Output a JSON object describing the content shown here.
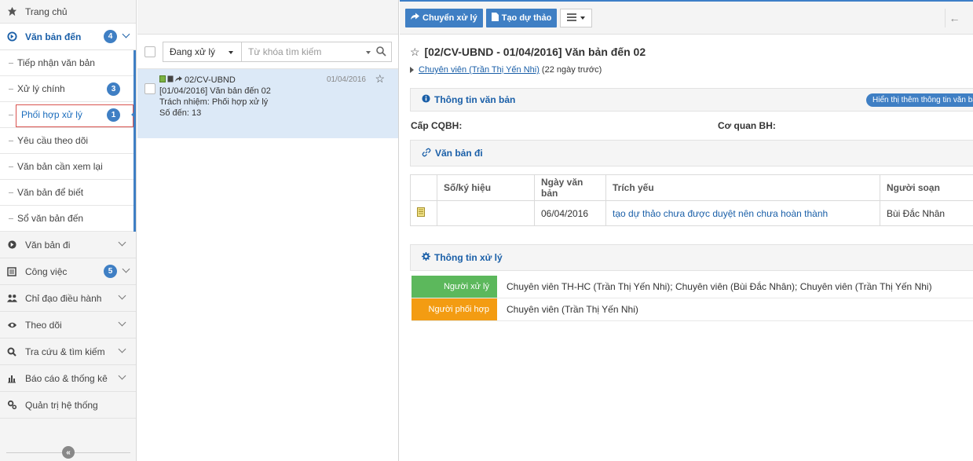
{
  "sidebar": {
    "home": "Trang chủ",
    "incoming": {
      "label": "Văn bản đến",
      "badge": "4"
    },
    "sub_items": [
      {
        "label": "Tiếp nhận văn bản"
      },
      {
        "label": "Xử lý chính",
        "badge": "3"
      },
      {
        "label": "Phối hợp xử lý",
        "badge": "1"
      },
      {
        "label": "Yêu cầu theo dõi"
      },
      {
        "label": "Văn bản cần xem lại"
      },
      {
        "label": "Văn bản để biết"
      },
      {
        "label": "Sổ văn bản đến"
      }
    ],
    "groups": [
      {
        "label": "Văn bản đi",
        "icon": "arrow-circle-icon"
      },
      {
        "label": "Công việc",
        "badge": "5",
        "icon": "list-icon"
      },
      {
        "label": "Chỉ đạo điều hành",
        "icon": "users-icon"
      },
      {
        "label": "Theo dõi",
        "icon": "eye-icon"
      },
      {
        "label": "Tra cứu & tìm kiếm",
        "icon": "search-icon"
      },
      {
        "label": "Báo cáo & thống kê",
        "icon": "bar-chart-icon"
      },
      {
        "label": "Quản trị hệ thống",
        "icon": "gears-icon"
      }
    ],
    "collapse_glyph": "«"
  },
  "list": {
    "status_filter": "Đang xử lý",
    "search_placeholder": "Từ khóa tìm kiếm",
    "item": {
      "code": "02/CV-UBND",
      "date": "01/04/2016",
      "line1": "[01/04/2016] Văn bản đến 02",
      "line2": "Trách nhiệm: Phối hợp xử lý",
      "line3": "Số đến: 13"
    }
  },
  "toolbar": {
    "forward_label": "Chuyển xử lý",
    "draft_label": "Tạo dự thảo",
    "back_glyph": "←"
  },
  "detail": {
    "title": "[02/CV-UBND - 01/04/2016] Văn bản đến 02",
    "star": "☆",
    "assignee": "Chuyên viên (Trần Thị Yến Nhi)",
    "assignee_age": " (22 ngày trước)",
    "doc_info_title": "Thông tin văn bản",
    "more_info_btn": "Hiển thị thêm thông tin văn bản",
    "issuer_label": "Cấp CQBH:",
    "agency_label": "Cơ quan BH:",
    "outgoing_title": "Văn bản đi",
    "out_table": {
      "headers": [
        "Số/ký hiệu",
        "Ngày văn bản",
        "Trích yếu",
        "Người soạn"
      ],
      "rows": [
        {
          "number": "",
          "date": "06/04/2016",
          "summary": "tạo dự thảo chưa được duyệt nên chưa hoàn thành",
          "author": "Bùi Đắc Nhân"
        }
      ]
    },
    "processing_title": "Thông tin xử lý",
    "processing": [
      {
        "label": "Người xử lý",
        "value": "Chuyên viên TH-HC (Trần Thị Yến Nhi); Chuyên viên (Bùi Đắc Nhân); Chuyên viên (Trần Thị Yến Nhi)",
        "color": "#5cb85c"
      },
      {
        "label": "Người phối hợp",
        "value": "Chuyên viên (Trần Thị Yến Nhi)",
        "color": "#f0ad4e"
      }
    ]
  },
  "colors": {
    "accent": "#3f7fc4",
    "link": "#1a5fa8",
    "selection_border": "#d9534f"
  }
}
